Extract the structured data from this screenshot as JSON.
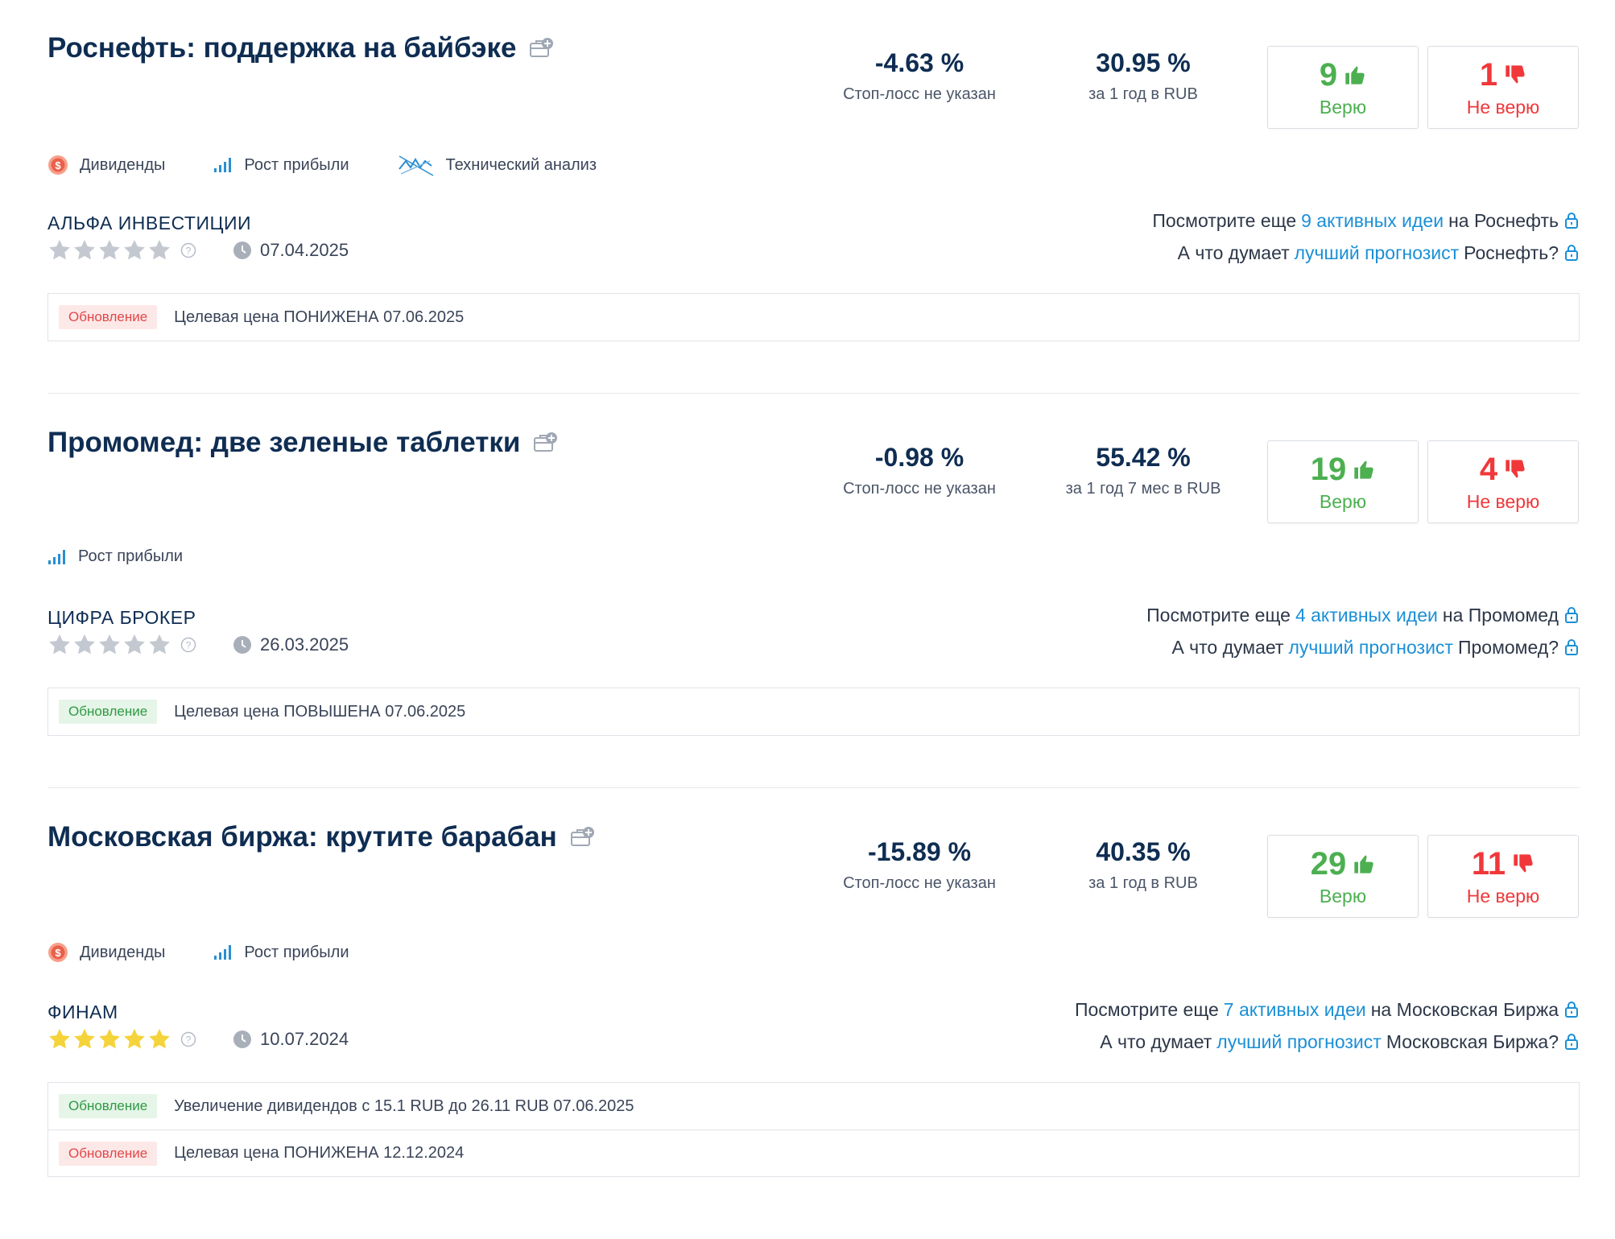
{
  "colors": {
    "green": "#4caf50",
    "red": "#f0383a",
    "link": "#1a8fd6",
    "title": "#0f2d52",
    "star_filled": "#f5d33a",
    "star_empty": "#c4c9d1"
  },
  "ideas": [
    {
      "title": "Роснефть: поддержка на байбэке",
      "metric1": {
        "value": "-4.63 %",
        "label": "Стоп-лосс не указан"
      },
      "metric2": {
        "value": "30.95 %",
        "label": "за 1 год в RUB"
      },
      "believe": {
        "count": "9",
        "label": "Верю"
      },
      "disbelieve": {
        "count": "1",
        "label": "Не верю"
      },
      "tags": [
        {
          "icon": "dividend-icon",
          "label": "Дивиденды"
        },
        {
          "icon": "profit-growth-icon",
          "label": "Рост прибыли"
        },
        {
          "icon": "technical-analysis-icon",
          "label": "Технический анализ"
        }
      ],
      "broker": "АЛЬФА ИНВЕСТИЦИИ",
      "stars": 0,
      "date": "07.04.2025",
      "more_prefix": "Посмотрите еще",
      "more_link": "9 активных идеи",
      "more_suffix": "на Роснефть",
      "forecast_prefix": "А что думает",
      "forecast_link": "лучший прогнозист",
      "forecast_suffix": "Роснефть?",
      "updates": [
        {
          "badge": "Обновление",
          "type": "red",
          "text": "Целевая цена ПОНИЖЕНА 07.06.2025"
        }
      ]
    },
    {
      "title": "Промомед: две зеленые таблетки",
      "metric1": {
        "value": "-0.98 %",
        "label": "Стоп-лосс не указан"
      },
      "metric2": {
        "value": "55.42 %",
        "label": "за 1 год 7 мес в RUB"
      },
      "believe": {
        "count": "19",
        "label": "Верю"
      },
      "disbelieve": {
        "count": "4",
        "label": "Не верю"
      },
      "tags": [
        {
          "icon": "profit-growth-icon",
          "label": "Рост прибыли"
        }
      ],
      "broker": "ЦИФРА БРОКЕР",
      "stars": 0,
      "date": "26.03.2025",
      "more_prefix": "Посмотрите еще",
      "more_link": "4 активных идеи",
      "more_suffix": "на Промомед",
      "forecast_prefix": "А что думает",
      "forecast_link": "лучший прогнозист",
      "forecast_suffix": "Промомед?",
      "updates": [
        {
          "badge": "Обновление",
          "type": "green",
          "text": "Целевая цена ПОВЫШЕНА 07.06.2025"
        }
      ]
    },
    {
      "title": "Московская биржа: крутите барабан",
      "metric1": {
        "value": "-15.89 %",
        "label": "Стоп-лосс не указан"
      },
      "metric2": {
        "value": "40.35 %",
        "label": "за 1 год в RUB"
      },
      "believe": {
        "count": "29",
        "label": "Верю"
      },
      "disbelieve": {
        "count": "11",
        "label": "Не верю"
      },
      "tags": [
        {
          "icon": "dividend-icon",
          "label": "Дивиденды"
        },
        {
          "icon": "profit-growth-icon",
          "label": "Рост прибыли"
        }
      ],
      "broker": "ФИНАМ",
      "stars": 5,
      "date": "10.07.2024",
      "more_prefix": "Посмотрите еще",
      "more_link": "7 активных идеи",
      "more_suffix": "на Московская Биржа",
      "forecast_prefix": "А что думает",
      "forecast_link": "лучший прогнозист",
      "forecast_suffix": "Московская Биржа?",
      "updates": [
        {
          "badge": "Обновление",
          "type": "green",
          "text": "Увеличение дивидендов с 15.1 RUB до 26.11 RUB 07.06.2025"
        },
        {
          "badge": "Обновление",
          "type": "red",
          "text": "Целевая цена ПОНИЖЕНА 12.12.2024"
        }
      ]
    }
  ]
}
